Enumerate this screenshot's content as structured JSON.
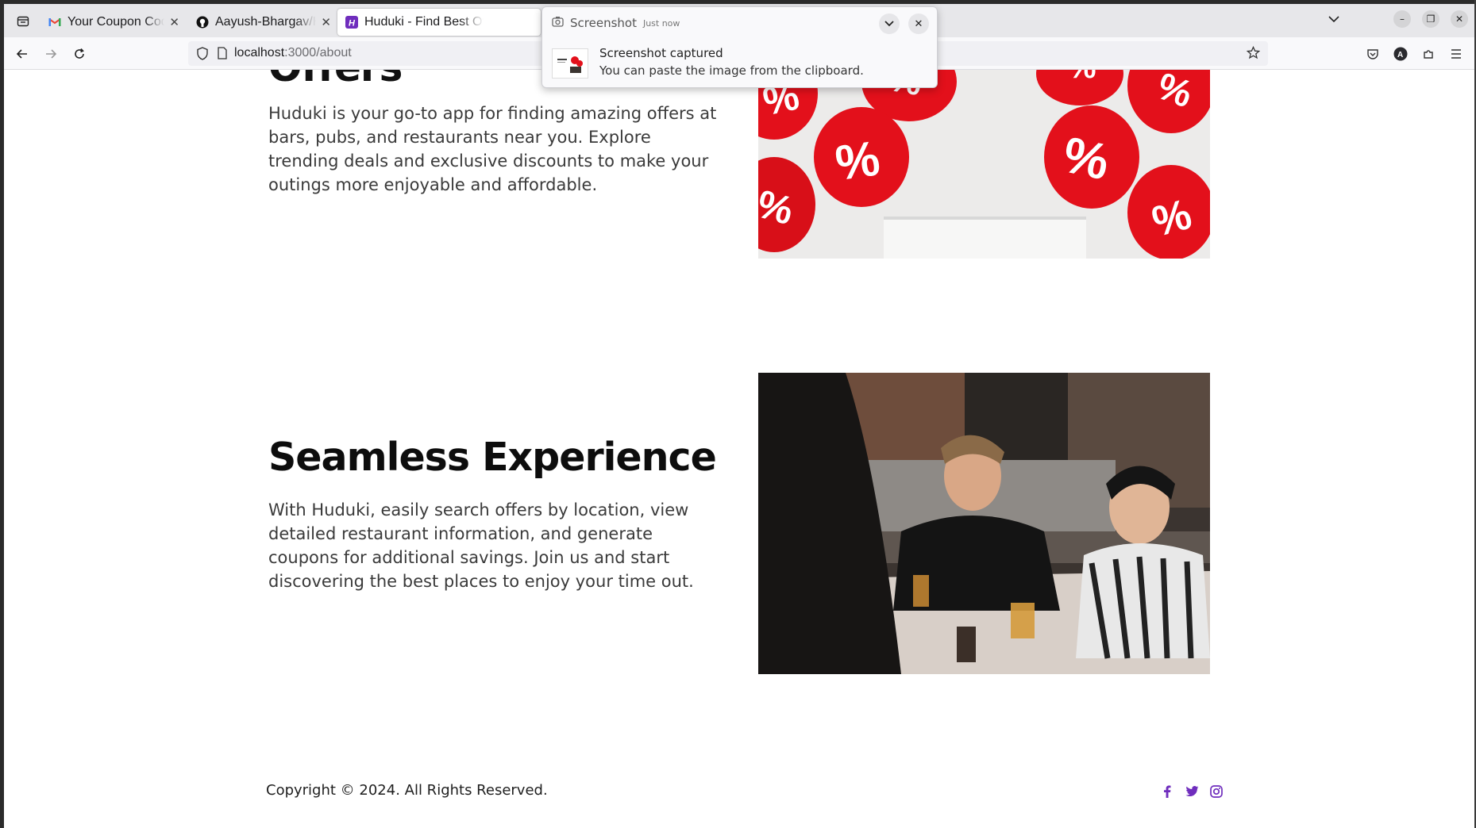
{
  "browser": {
    "tabs": [
      {
        "title": "Your Coupon Code - aayu",
        "icon": "gmail-icon"
      },
      {
        "title": "Aayush-Bhargav/Huduki-F",
        "icon": "github-icon"
      },
      {
        "title": "Huduki - Find Best Offe",
        "icon": "huduki-icon",
        "active": true
      }
    ],
    "url_host": "localhost",
    "url_path": ":3000/about"
  },
  "notification": {
    "app": "Screenshot",
    "time": "Just now",
    "title": "Screenshot captured",
    "body": "You can paste the image from the clipboard."
  },
  "sections": [
    {
      "heading_partial": "Offers",
      "text": "Huduki is your go-to app for finding amazing offers at bars, pubs, and restaurants near you. Explore trending deals and exclusive discounts to make your outings more enjoyable and affordable."
    },
    {
      "heading": "Seamless Experience",
      "text": "With Huduki, easily search offers by location, view detailed restaurant information, and generate coupons for additional savings. Join us and start discovering the best places to enjoy your time out."
    }
  ],
  "footer": {
    "copyright": "Copyright © 2024. All Rights Reserved.",
    "social": [
      "facebook-icon",
      "twitter-icon",
      "instagram-icon"
    ]
  },
  "colors": {
    "accent": "#6f2dbd",
    "balloon_red": "#e3101b"
  }
}
